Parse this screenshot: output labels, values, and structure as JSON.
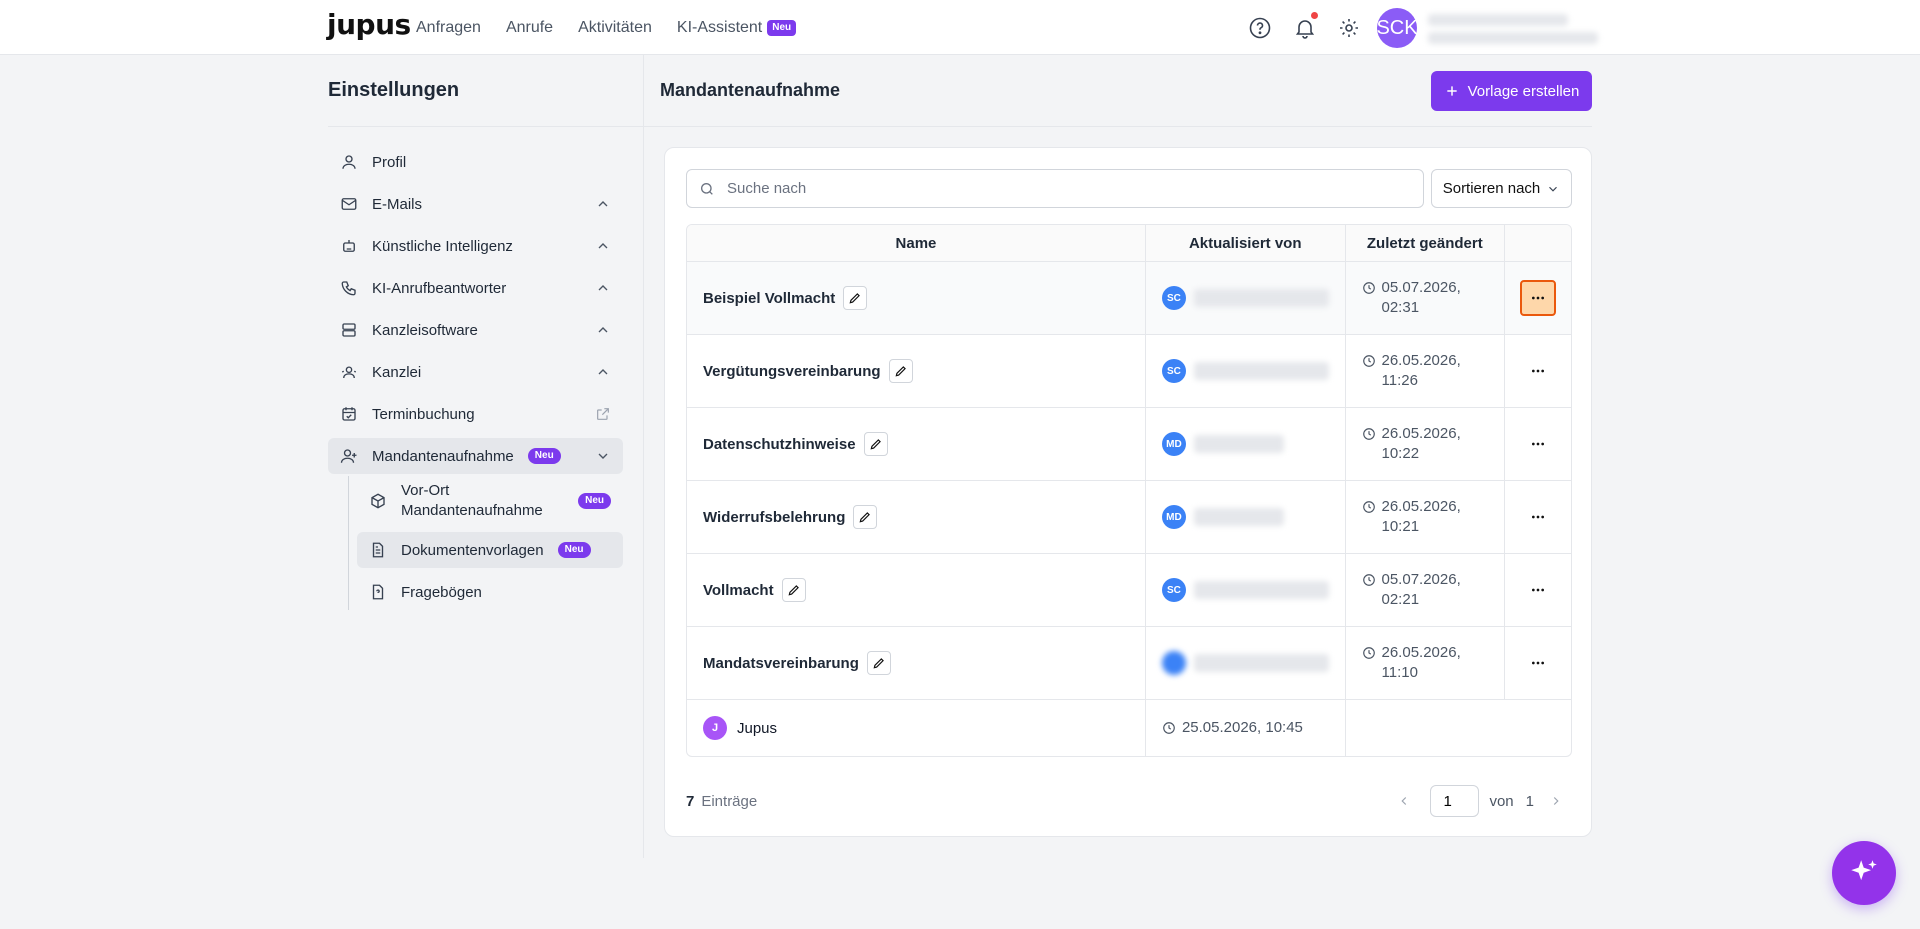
{
  "topnav": {
    "logo": "jupus",
    "items": [
      {
        "label": "Anfragen"
      },
      {
        "label": "Anrufe"
      },
      {
        "label": "Aktivitäten"
      },
      {
        "label": "KI-Assistent",
        "badge": "Neu"
      }
    ],
    "avatar_initials": "SCK"
  },
  "sidebar": {
    "title": "Einstellungen",
    "items": [
      {
        "label": "Profil",
        "icon": "user-icon"
      },
      {
        "label": "E-Mails",
        "icon": "mail-icon"
      },
      {
        "label": "Künstliche Intelligenz",
        "icon": "robot-icon"
      },
      {
        "label": "KI-Anrufbeantworter",
        "icon": "phone-icon"
      },
      {
        "label": "Kanzleisoftware",
        "icon": "server-icon"
      },
      {
        "label": "Kanzlei",
        "icon": "users-icon"
      },
      {
        "label": "Terminbuchung",
        "icon": "calendar-check-icon"
      },
      {
        "label": "Mandantenaufnahme",
        "icon": "user-plus-icon",
        "badge": "Neu"
      }
    ],
    "subitems": [
      {
        "label": "Vor-Ort Mandantenaufnahme",
        "badge": "Neu"
      },
      {
        "label": "Dokumentenvorlagen",
        "badge": "Neu"
      },
      {
        "label": "Fragebögen"
      }
    ]
  },
  "main": {
    "title": "Mandantenaufnahme",
    "create_button": "Vorlage erstellen",
    "search_placeholder": "Suche nach",
    "sort_label": "Sortieren nach",
    "columns": [
      "Name",
      "Aktualisiert von",
      "Zuletzt geändert"
    ],
    "rows": [
      {
        "name": "Beispiel Vollmacht",
        "initials": "SC",
        "date": "05.07.2026,",
        "time": "02:31"
      },
      {
        "name": "Vergütungsvereinbarung",
        "initials": "SC",
        "date": "26.05.2026,",
        "time": "11:26"
      },
      {
        "name": "Datenschutzhinweise",
        "initials": "MD",
        "date": "26.05.2026,",
        "time": "10:22"
      },
      {
        "name": "Widerrufsbelehrung",
        "initials": "MD",
        "date": "26.05.2026,",
        "time": "10:21"
      },
      {
        "name": "Vollmacht",
        "initials": "SC",
        "date": "05.07.2026,",
        "time": "02:21"
      },
      {
        "name": "Mandatsvereinbarung",
        "initials": "",
        "date": "26.05.2026,",
        "time": "11:10"
      }
    ],
    "last_row": {
      "initial": "J",
      "name": "Jupus",
      "datetime": "25.05.2026, 10:45"
    },
    "count": "7",
    "count_label": "Einträge",
    "page": "1",
    "page_of": "von",
    "page_total": "1"
  }
}
